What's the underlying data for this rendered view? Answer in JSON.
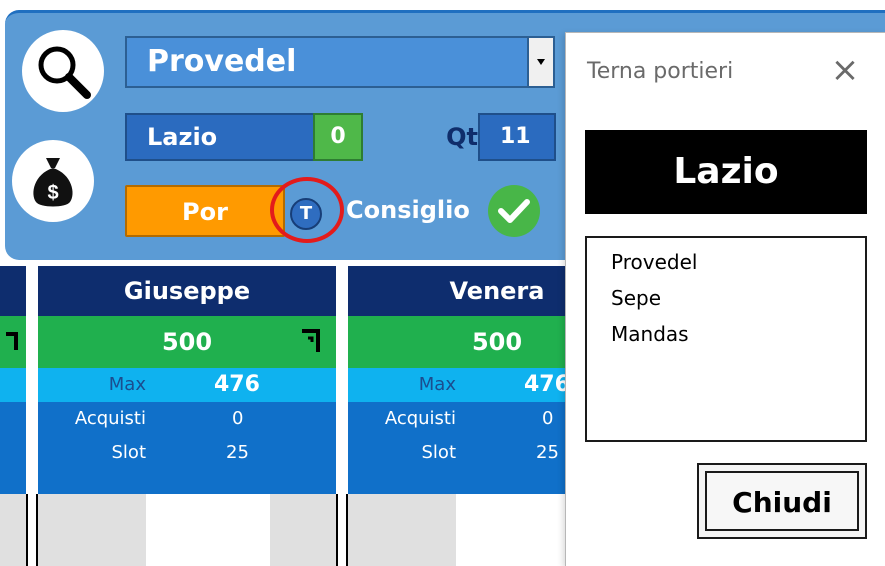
{
  "top": {
    "player_name": "Provedel",
    "team": "Lazio",
    "team_count": "0",
    "qt_label": "Qt",
    "qt_value": "11",
    "role": "Por",
    "t_label": "T",
    "consiglio": "Consiglio"
  },
  "cards": [
    {
      "name": "Giuseppe",
      "budget": "500",
      "max_label": "Max",
      "max_value": "476",
      "acquisti_label": "Acquisti",
      "acquisti_value": "0",
      "slot_label": "Slot",
      "slot_value": "25"
    },
    {
      "name": "Venera",
      "budget": "500",
      "max_label": "Max",
      "max_value": "476",
      "acquisti_label": "Acquisti",
      "acquisti_value": "0",
      "slot_label": "Slot",
      "slot_value": "25"
    }
  ],
  "dialog": {
    "title": "Terna portieri",
    "team": "Lazio",
    "players": [
      "Provedel",
      "Sepe",
      "Mandas"
    ],
    "close_button": "Chiudi",
    "close_icon": "×"
  },
  "colors": {
    "panel": "#5b9bd5",
    "card_header": "#0e2d6e",
    "card_budget": "#20b04e",
    "card_max": "#0fb2ef",
    "card_body": "#1070c9",
    "role": "#ff9a00",
    "highlight": "#e31b1b"
  }
}
